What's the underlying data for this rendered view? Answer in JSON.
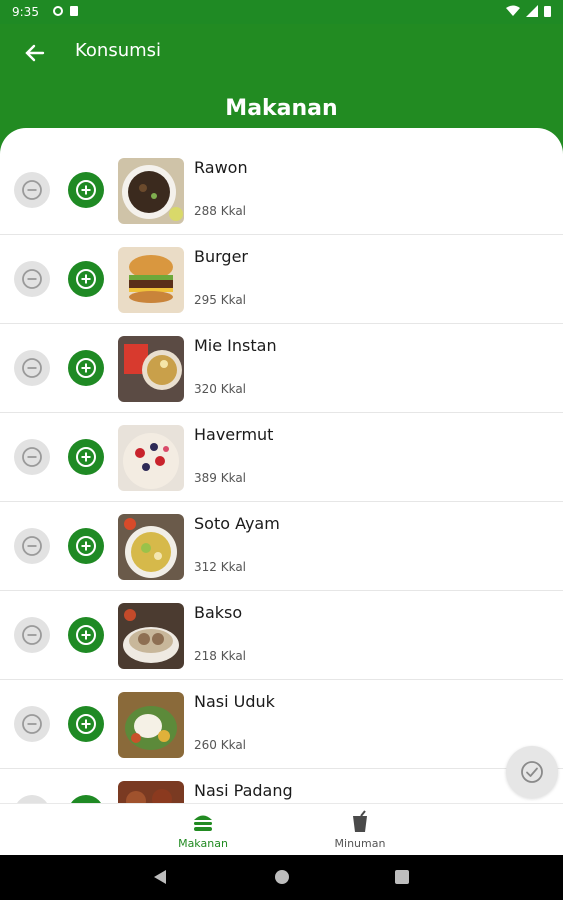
{
  "status_bar": {
    "time": "9:35"
  },
  "app_bar": {
    "title": "Konsumsi",
    "section_title": "Makanan"
  },
  "foods": [
    {
      "name": "Rawon",
      "kcal": "288 Kkal"
    },
    {
      "name": "Burger",
      "kcal": "295 Kkal"
    },
    {
      "name": "Mie Instan",
      "kcal": "320 Kkal"
    },
    {
      "name": "Havermut",
      "kcal": "389 Kkal"
    },
    {
      "name": "Soto Ayam",
      "kcal": "312 Kkal"
    },
    {
      "name": "Bakso",
      "kcal": "218 Kkal"
    },
    {
      "name": "Nasi Uduk",
      "kcal": "260 Kkal"
    },
    {
      "name": "Nasi Padang",
      "kcal": ""
    }
  ],
  "bottom_nav": [
    {
      "label": "Makanan",
      "icon": "burger-icon",
      "active": true
    },
    {
      "label": "Minuman",
      "icon": "drink-icon",
      "active": false
    }
  ],
  "colors": {
    "primary": "#228b22",
    "accent": "#1f8a24",
    "inactive": "#555555"
  }
}
